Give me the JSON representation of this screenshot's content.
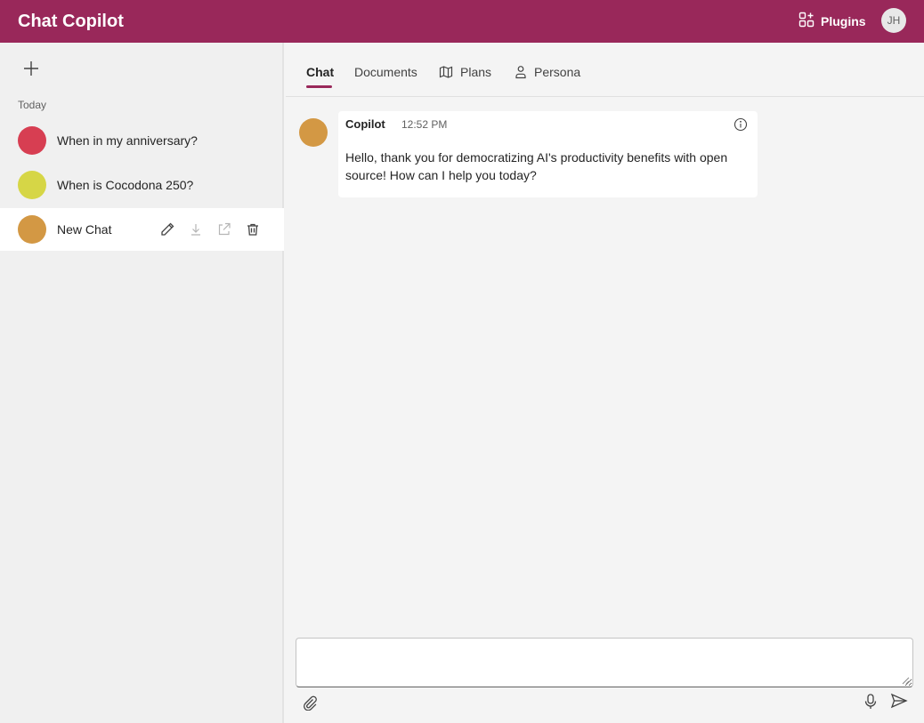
{
  "header": {
    "app_title": "Chat Copilot",
    "plugins_label": "Plugins",
    "user_initials": "JH",
    "brand_color": "#99285a"
  },
  "sidebar": {
    "section_label": "Today",
    "chats": [
      {
        "title": "When in my anniversary?",
        "color": "#d73e52"
      },
      {
        "title": "When is Cocodona 250?",
        "color": "#d6d646"
      },
      {
        "title": "New Chat",
        "color": "#d39844",
        "selected": true
      }
    ],
    "item_action_icons": [
      "pencil-icon",
      "download-icon",
      "share-icon",
      "trash-icon"
    ]
  },
  "tabs": [
    {
      "label": "Chat",
      "active": true
    },
    {
      "label": "Documents",
      "icon": ""
    },
    {
      "label": "Plans",
      "icon": "map-icon"
    },
    {
      "label": "Persona",
      "icon": "person-icon"
    }
  ],
  "message": {
    "author": "Copilot",
    "time": "12:52 PM",
    "text": "Hello, thank you for democratizing AI's productivity benefits with open source! How can I help you today?",
    "avatar_color": "#d39844"
  },
  "composer": {
    "placeholder": "",
    "value": ""
  }
}
